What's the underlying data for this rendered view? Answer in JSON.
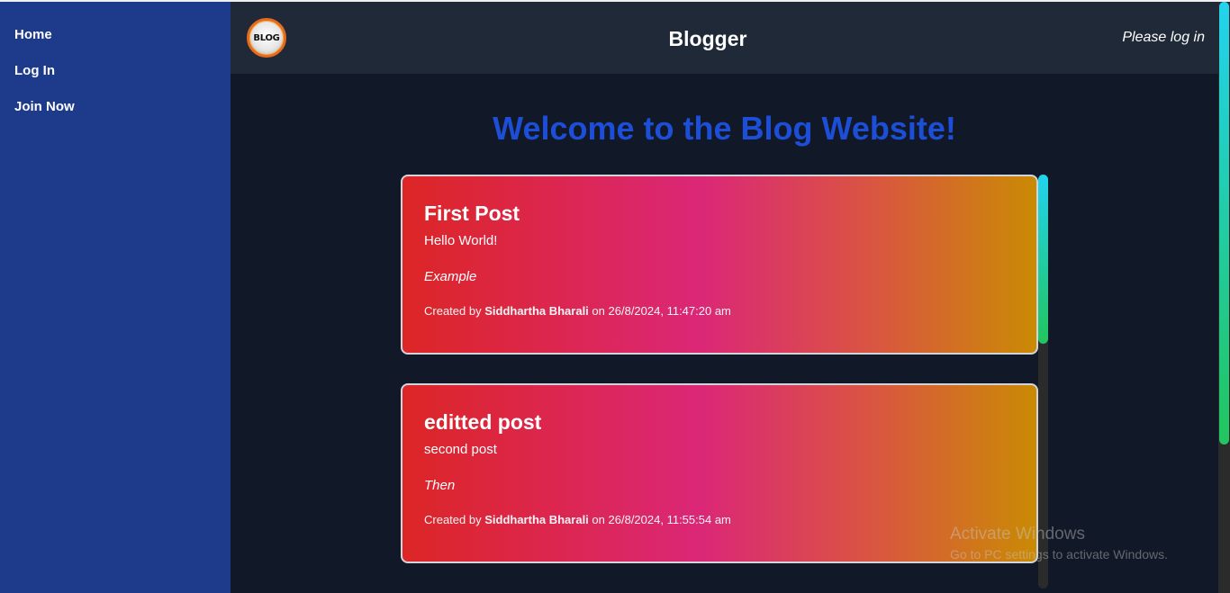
{
  "sidebar": {
    "items": [
      {
        "label": "Home"
      },
      {
        "label": "Log In"
      },
      {
        "label": "Join Now"
      }
    ]
  },
  "header": {
    "logo_text": "BLOG",
    "title": "Blogger",
    "login_status": "Please log in"
  },
  "main": {
    "welcome": "Welcome to the Blog Website!",
    "posts": [
      {
        "title": "First Post",
        "body": "Hello World!",
        "tag": "Example",
        "created_prefix": "Created by",
        "author": "Siddhartha Bharali",
        "on_text": "on",
        "timestamp": "26/8/2024, 11:47:20 am"
      },
      {
        "title": "editted post",
        "body": "second post",
        "tag": "Then",
        "created_prefix": "Created by",
        "author": "Siddhartha Bharali",
        "on_text": "on",
        "timestamp": "26/8/2024, 11:55:54 am"
      }
    ]
  },
  "watermark": {
    "line1": "Activate Windows",
    "line2": "Go to PC settings to activate Windows."
  },
  "colors": {
    "sidebar_bg": "#1e3a8a",
    "header_bg": "#1f2937",
    "main_bg": "#111827",
    "welcome_text": "#1d4ed8",
    "card_gradient_start": "#dc2626",
    "card_gradient_mid": "#db2777",
    "card_gradient_end": "#ca8a04",
    "scroll_thumb_top": "#22d3ee",
    "scroll_thumb_bottom": "#22c55e"
  }
}
